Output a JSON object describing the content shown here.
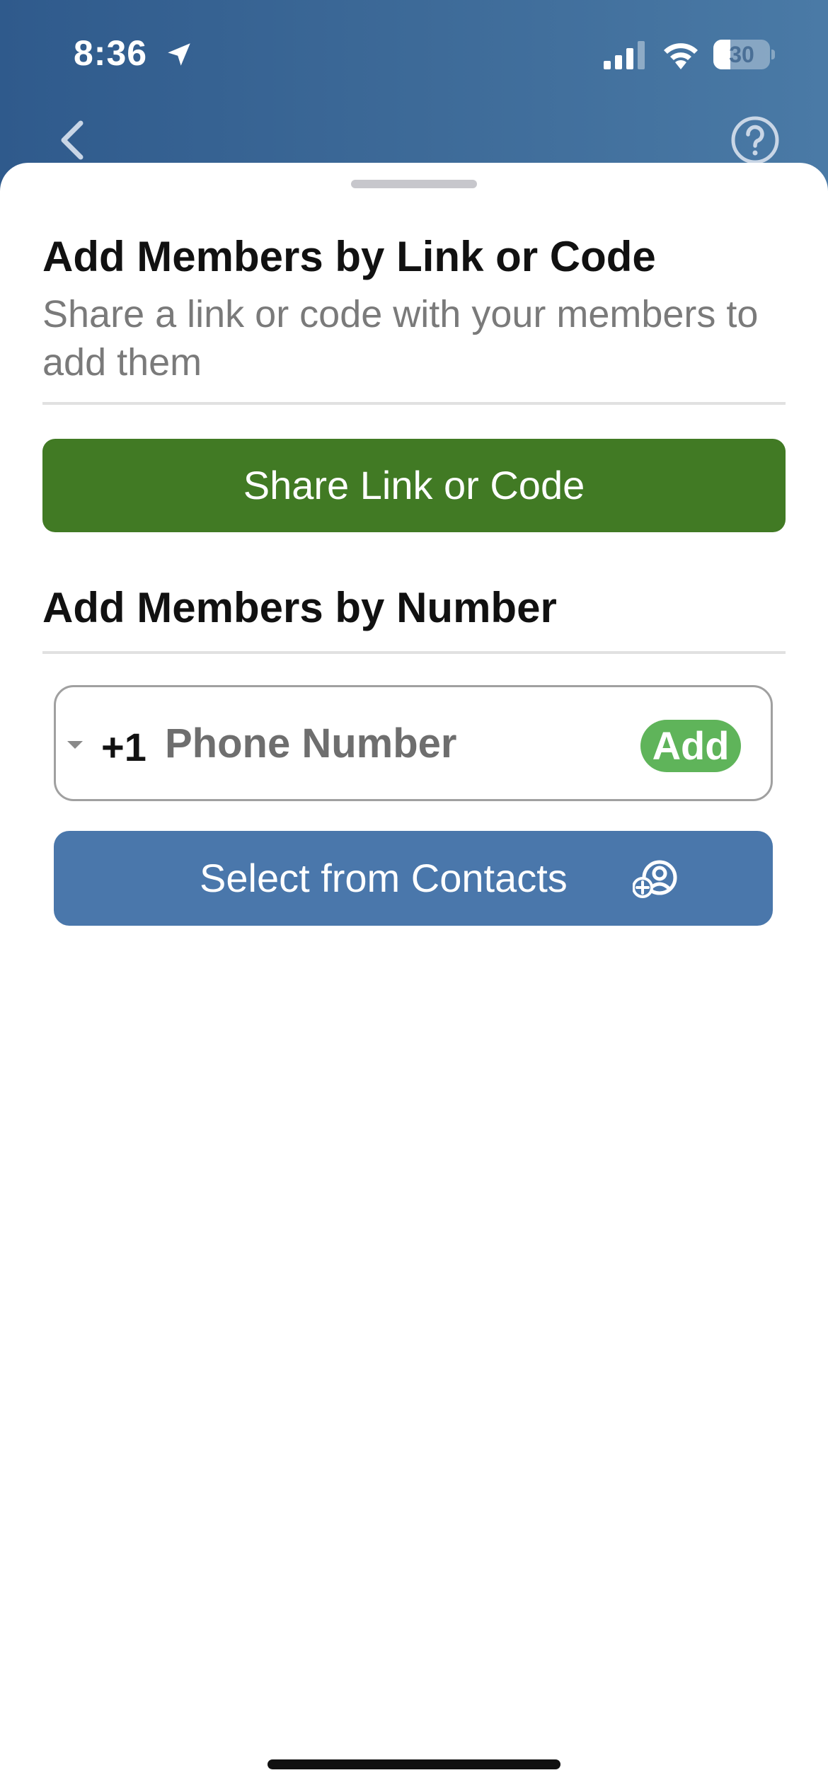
{
  "status_bar": {
    "time": "8:36",
    "battery_level": "30",
    "battery_fraction": 0.3,
    "icons": [
      "location-arrow-icon",
      "cellular-signal-icon",
      "wifi-icon",
      "battery-icon"
    ]
  },
  "nav": {
    "icons": [
      "chevron-left-icon",
      "help-circle-icon"
    ]
  },
  "link_section": {
    "title": "Add Members by Link or Code",
    "subtitle": "Share a link or code with your members to add them",
    "share_button_label": "Share Link or Code"
  },
  "number_section": {
    "title": "Add Members by Number",
    "country_code": "+1",
    "phone_placeholder": "Phone Number",
    "phone_value": "",
    "add_button_label": "Add",
    "contacts_button_label": "Select from Contacts",
    "contacts_icon": "add-contact-icon"
  },
  "colors": {
    "header_blue": "#3d6a98",
    "share_green": "#417a24",
    "add_green": "#5fb45a",
    "contacts_blue": "#4a77ab"
  }
}
